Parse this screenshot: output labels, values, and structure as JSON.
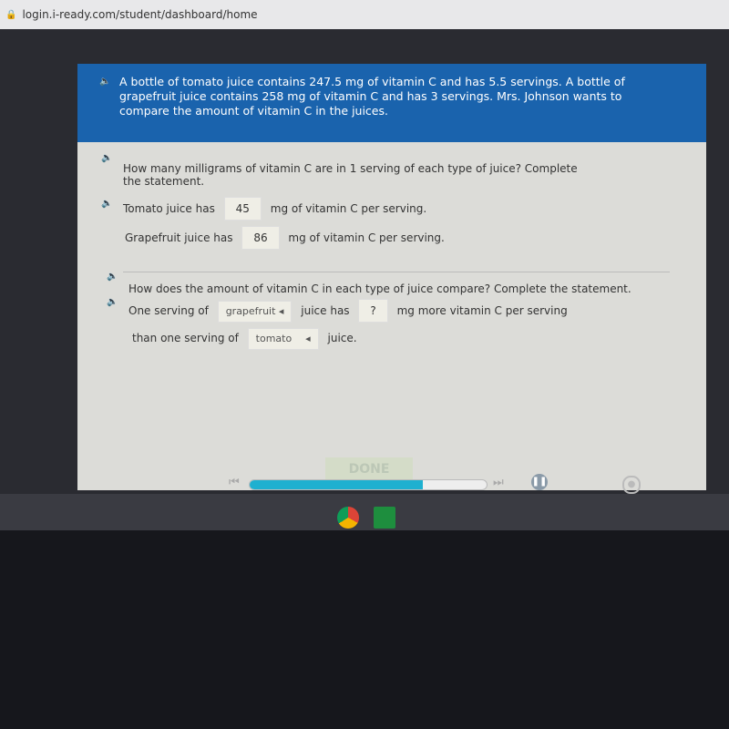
{
  "browser": {
    "url": "login.i-ready.com/student/dashboard/home"
  },
  "problem": {
    "text": "A bottle of tomato juice contains 247.5 mg of vitamin C and has 5.5 servings. A bottle of grapefruit juice contains 258 mg of vitamin C and has 3 servings. Mrs. Johnson wants to compare the amount of vitamin C in the juices."
  },
  "part1": {
    "question": "How many milligrams of vitamin C are in 1 serving of each type of juice? Complete the statement.",
    "row1": {
      "prefix": "Tomato juice has",
      "value": "45",
      "suffix": "mg of vitamin C per serving."
    },
    "row2": {
      "prefix": "Grapefruit juice has",
      "value": "86",
      "suffix": "mg of vitamin C per serving."
    }
  },
  "part2": {
    "question": "How does the amount of vitamin C in each type of juice compare? Complete the statement.",
    "s1": "One serving of",
    "dropdown1": "grapefruit",
    "s2": "juice has",
    "value": "?",
    "s3": "mg more vitamin C per serving",
    "s4": "than one serving of",
    "dropdown2": "tomato",
    "s5": "juice."
  },
  "done_label": "DONE",
  "progress": 0.73,
  "colors": {
    "header": "#1a63ad",
    "progress": "#1fb0d0"
  },
  "icons": [
    "lock-icon",
    "speaker-icon",
    "caret-left-icon",
    "skip-back-icon",
    "skip-forward-icon",
    "pause-icon",
    "settings-icon",
    "chrome-icon",
    "classroom-icon"
  ]
}
